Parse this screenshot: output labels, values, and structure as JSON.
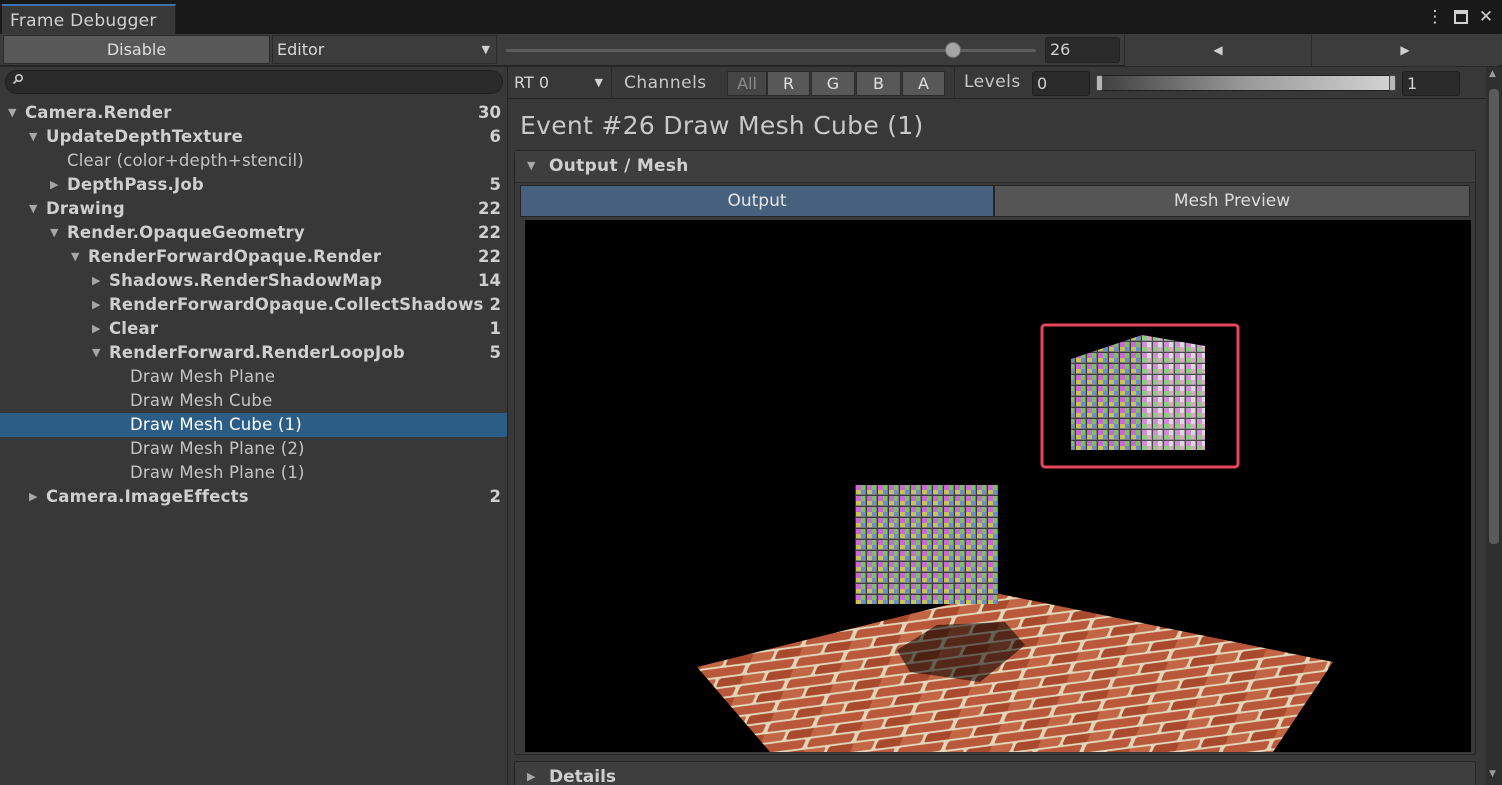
{
  "window": {
    "tab_title": "Frame Debugger",
    "menu_icon": "kebab-menu-icon",
    "maximize_icon": "maximize-icon",
    "close_icon": "close-icon"
  },
  "toolbar": {
    "disable_label": "Disable",
    "target_dropdown": "Editor",
    "event_slider_value": 26,
    "event_slider_max": 30,
    "event_index": "26",
    "prev_icon": "triangle-left-icon",
    "next_icon": "triangle-right-icon"
  },
  "search": {
    "placeholder": "",
    "icon": "search-icon"
  },
  "tree": [
    {
      "label": "Camera.Render",
      "count": "30",
      "depth": 0,
      "expanded": true,
      "bold": true
    },
    {
      "label": "UpdateDepthTexture",
      "count": "6",
      "depth": 1,
      "expanded": true,
      "bold": true
    },
    {
      "label": "Clear (color+depth+stencil)",
      "count": "",
      "depth": 2,
      "leaf": true,
      "bold": false
    },
    {
      "label": "DepthPass.Job",
      "count": "5",
      "depth": 2,
      "expanded": false,
      "bold": true
    },
    {
      "label": "Drawing",
      "count": "22",
      "depth": 1,
      "expanded": true,
      "bold": true
    },
    {
      "label": "Render.OpaqueGeometry",
      "count": "22",
      "depth": 2,
      "expanded": true,
      "bold": true
    },
    {
      "label": "RenderForwardOpaque.Render",
      "count": "22",
      "depth": 3,
      "expanded": true,
      "bold": true
    },
    {
      "label": "Shadows.RenderShadowMap",
      "count": "14",
      "depth": 4,
      "expanded": false,
      "bold": true
    },
    {
      "label": "RenderForwardOpaque.CollectShadows",
      "count": "2",
      "depth": 4,
      "expanded": false,
      "bold": true
    },
    {
      "label": "Clear",
      "count": "1",
      "depth": 4,
      "expanded": false,
      "bold": true
    },
    {
      "label": "RenderForward.RenderLoopJob",
      "count": "5",
      "depth": 4,
      "expanded": true,
      "bold": true
    },
    {
      "label": "Draw Mesh Plane",
      "count": "",
      "depth": 5,
      "leaf": true,
      "bold": false
    },
    {
      "label": "Draw Mesh Cube",
      "count": "",
      "depth": 5,
      "leaf": true,
      "bold": false
    },
    {
      "label": "Draw Mesh Cube (1)",
      "count": "",
      "depth": 5,
      "leaf": true,
      "bold": false,
      "selected": true
    },
    {
      "label": "Draw Mesh Plane (2)",
      "count": "",
      "depth": 5,
      "leaf": true,
      "bold": false
    },
    {
      "label": "Draw Mesh Plane (1)",
      "count": "",
      "depth": 5,
      "leaf": true,
      "bold": false
    },
    {
      "label": "Camera.ImageEffects",
      "count": "2",
      "depth": 1,
      "expanded": false,
      "bold": true
    }
  ],
  "rt": {
    "target": "RT 0",
    "channels_label": "Channels",
    "channels": [
      "All",
      "R",
      "G",
      "B",
      "A"
    ],
    "levels_label": "Levels",
    "levels_min": "0",
    "levels_max": "1"
  },
  "event": {
    "title": "Event #26 Draw Mesh Cube (1)"
  },
  "output_panel": {
    "header": "Output / Mesh",
    "tabs": [
      "Output",
      "Mesh Preview"
    ],
    "active_tab": "Output",
    "highlight_color": "#e8465a"
  },
  "details": {
    "header": "Details"
  },
  "colors": {
    "selection": "#2c5d87",
    "active_tab": "#46607e",
    "panel": "#383838"
  }
}
